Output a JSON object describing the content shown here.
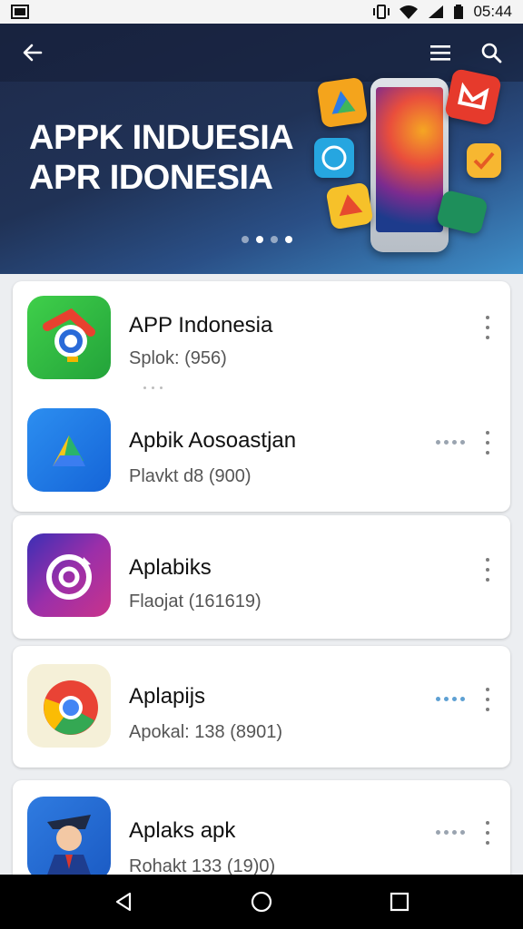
{
  "status_bar": {
    "time": "05:44"
  },
  "banner": {
    "title_line1": "APPK INDUESIA",
    "title_line2": "APR IDONESIA",
    "carousel_pages": 4,
    "carousel_active": 2
  },
  "apps": [
    {
      "name": "APP Indonesia",
      "subtitle": "Splok: (956)"
    },
    {
      "name": "Apbik Aosoastjan",
      "subtitle": "Plavkt d8 (900)"
    },
    {
      "name": "Aplabiks",
      "subtitle": "Flaojat (161619)"
    },
    {
      "name": "Aplapijs",
      "subtitle": "Apokal: 138 (8901)"
    },
    {
      "name": "Aplaks apk",
      "subtitle": "Rohakt 133 (19)0)"
    }
  ],
  "colors": {
    "banner_dark": "#1e2a4a",
    "banner_light": "#3f8fc9",
    "accent_blue": "#5ea0d3"
  }
}
